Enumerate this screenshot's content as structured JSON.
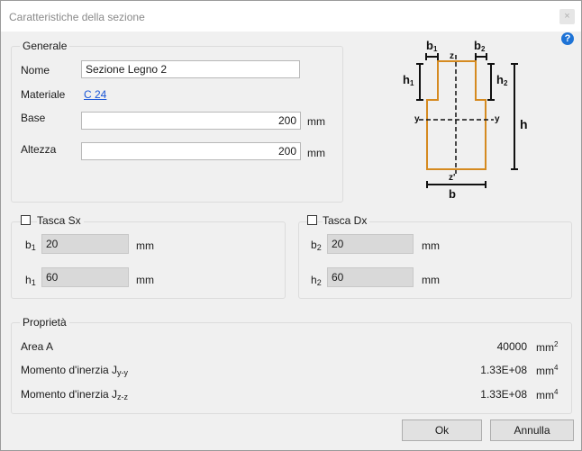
{
  "window": {
    "title": "Caratteristiche della sezione",
    "close_glyph": "×",
    "help_glyph": "?"
  },
  "generale": {
    "legend": "Generale",
    "nome_label": "Nome",
    "nome_value": "Sezione Legno 2",
    "materiale_label": "Materiale",
    "materiale_value": "C 24",
    "base_label": "Base",
    "base_value": "200",
    "base_unit": "mm",
    "altezza_label": "Altezza",
    "altezza_value": "200",
    "altezza_unit": "mm"
  },
  "diagram": {
    "b1": "b",
    "b1_sub": "1",
    "b2": "b",
    "b2_sub": "2",
    "h1": "h",
    "h1_sub": "1",
    "h2": "h",
    "h2_sub": "2",
    "h": "h",
    "b": "b",
    "z_top": "z",
    "z_bottom": "z'",
    "y_left": "y",
    "y_right": "y",
    "outline_color": "#d58a20"
  },
  "tasca_sx": {
    "legend": "Tasca Sx",
    "b_label": "b",
    "b_sub": "1",
    "b_value": "20",
    "b_unit": "mm",
    "h_label": "h",
    "h_sub": "1",
    "h_value": "60",
    "h_unit": "mm"
  },
  "tasca_dx": {
    "legend": "Tasca Dx",
    "b_label": "b",
    "b_sub": "2",
    "b_value": "20",
    "b_unit": "mm",
    "h_label": "h",
    "h_sub": "2",
    "h_value": "60",
    "h_unit": "mm"
  },
  "proprieta": {
    "legend": "Proprietà",
    "area_label": "Area A",
    "area_value": "40000",
    "area_unit": "mm",
    "area_unit_sup": "2",
    "jyy_label": "Momento d'inerzia J",
    "jyy_sub": "y-y",
    "jyy_value": "1.33E+08",
    "jyy_unit": "mm",
    "jyy_unit_sup": "4",
    "jzz_label": "Momento d'inerzia J",
    "jzz_sub": "z-z",
    "jzz_value": "1.33E+08",
    "jzz_unit": "mm",
    "jzz_unit_sup": "4"
  },
  "buttons": {
    "ok": "Ok",
    "annulla": "Annulla"
  }
}
